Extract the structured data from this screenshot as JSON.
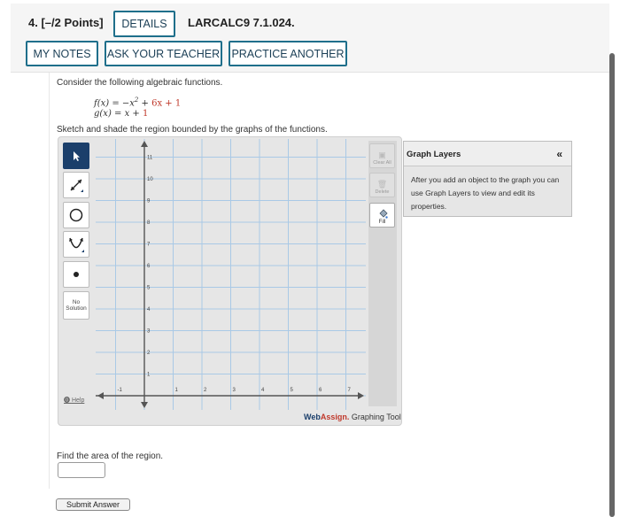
{
  "header": {
    "question_label": "4. [–/2 Points]",
    "details_label": "DETAILS",
    "problem_code": "LARCALC9 7.1.024.",
    "my_notes_label": "MY NOTES",
    "ask_teacher_label": "ASK YOUR TEACHER",
    "practice_label": "PRACTICE ANOTHER"
  },
  "problem": {
    "prompt": "Consider the following algebraic functions.",
    "f": {
      "lhs": "f(x) = −x",
      "exp": "2",
      "plus1": " + ",
      "term": "6x + 1"
    },
    "g": {
      "lhs": "g(x) = x + ",
      "term": "1"
    },
    "sketch_prompt": "Sketch and shade the region bounded by the graphs of the functions."
  },
  "graph_tool": {
    "tools": [
      "pointer",
      "line",
      "circle",
      "parabola",
      "point",
      "no-solution"
    ],
    "no_solution_label": [
      "No",
      "Solution"
    ],
    "help_label": "Help",
    "right_buttons": [
      "Clear All",
      "Delete",
      "Fill"
    ],
    "brand": {
      "web": "Web",
      "assign": "Assign.",
      "suffix": " Graphing Tool"
    },
    "axes": {
      "x_ticks": [
        "-1",
        "1",
        "2",
        "3",
        "4",
        "5",
        "6",
        "7"
      ],
      "y_ticks": [
        "1",
        "2",
        "3",
        "4",
        "5",
        "6",
        "7",
        "8",
        "9",
        "10",
        "11"
      ]
    }
  },
  "graph_layers": {
    "title": "Graph Layers",
    "collapse": "«",
    "message": "After you add an object to the graph you can use Graph Layers to view and edit its properties."
  },
  "answer": {
    "area_prompt": "Find the area of the region.",
    "value": "",
    "submit_label": "Submit Answer"
  },
  "colors": {
    "accent_border": "#1f6f8b",
    "active_tool": "#1b3f6b",
    "grid_line": "#a9c9e6",
    "axis": "#555555"
  }
}
